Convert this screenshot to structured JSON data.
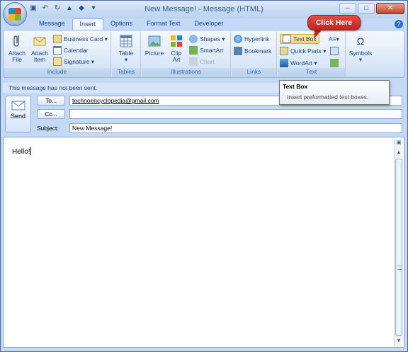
{
  "window": {
    "title": "New Message! - Message (HTML)",
    "controls": {
      "minimize": "–",
      "maximize": "□",
      "close": "✕"
    }
  },
  "qat": [
    "save",
    "undo",
    "redo",
    "up",
    "down",
    "dropdown"
  ],
  "tabs": [
    {
      "label": "Message"
    },
    {
      "label": "Insert",
      "active": true
    },
    {
      "label": "Options"
    },
    {
      "label": "Format Text"
    },
    {
      "label": "Developer"
    }
  ],
  "ribbon": {
    "include": {
      "label": "Include",
      "attach_file": "Attach\nFile",
      "attach_item": "Attach\nItem",
      "business_card": "Business Card ▾",
      "calendar": "Calendar",
      "signature": "Signature ▾"
    },
    "tables": {
      "label": "Tables",
      "table": "Table"
    },
    "illustrations": {
      "label": "Illustrations",
      "picture": "Picture",
      "clip_art": "Clip\nArt",
      "shapes": "Shapes ▾",
      "smartart": "SmartArt",
      "chart": "Chart"
    },
    "links": {
      "label": "Links",
      "hyperlink": "Hyperlink",
      "bookmark": "Bookmark"
    },
    "text": {
      "label": "Text",
      "text_box": "Text Box",
      "quick_parts": "Quick Parts ▾",
      "wordart": "WordArt ▾"
    },
    "symbols": {
      "label": "Symbols"
    }
  },
  "infobar": "This message has not been sent.",
  "compose": {
    "send": "Send",
    "to_button": "To...",
    "cc_button": "Cc...",
    "subject_label": "Subject:",
    "to_value": "technoencyclopedia@gmail.com",
    "cc_value": "",
    "subject_value": "New Message!"
  },
  "body_text": "Hello!",
  "tooltip": {
    "title": "Text Box",
    "description": "Insert preformatted text boxes."
  },
  "callout": "Click Here",
  "colors": {
    "accent": "#15428b",
    "callout": "#d0302a",
    "ribbon_bg": "#dbe8f8"
  }
}
